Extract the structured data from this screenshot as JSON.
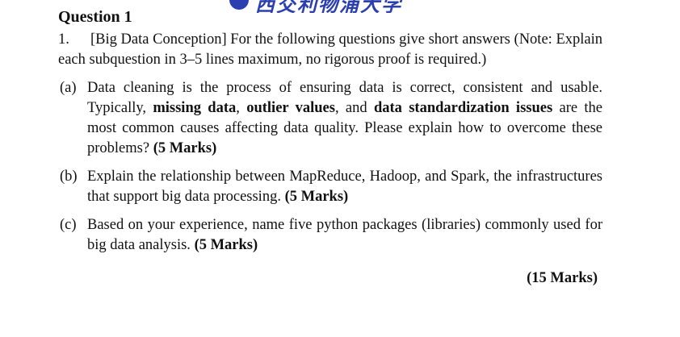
{
  "watermark": {
    "text": "西交利物浦大学"
  },
  "question": {
    "title": "Question 1",
    "number": "1.",
    "topic": "[Big Data Conception]",
    "intro": "For the following questions give short answers (Note: Explain each subquestion in 3–5 lines maximum, no rigorous proof is required.)"
  },
  "subquestions": [
    {
      "label": "(a)",
      "text_1": "Data cleaning is the process of ensuring data is correct, consistent and usable. Typically,",
      "bold_1": "missing data",
      "text_2": ",",
      "bold_2": "outlier values",
      "text_3": ", and",
      "bold_3": "data standardization issues",
      "text_4": "are the most common causes affecting data quality. Please explain how to overcome these problems?",
      "marks": "(5 Marks)"
    },
    {
      "label": "(b)",
      "text": "Explain the relationship between MapReduce, Hadoop, and Spark, the infrastructures that support big data processing.",
      "marks": "(5 Marks)"
    },
    {
      "label": "(c)",
      "text": "Based on your experience, name five python packages (libraries) commonly used for big data analysis.",
      "marks": "(5 Marks)"
    }
  ],
  "total_marks": "(15 Marks)"
}
